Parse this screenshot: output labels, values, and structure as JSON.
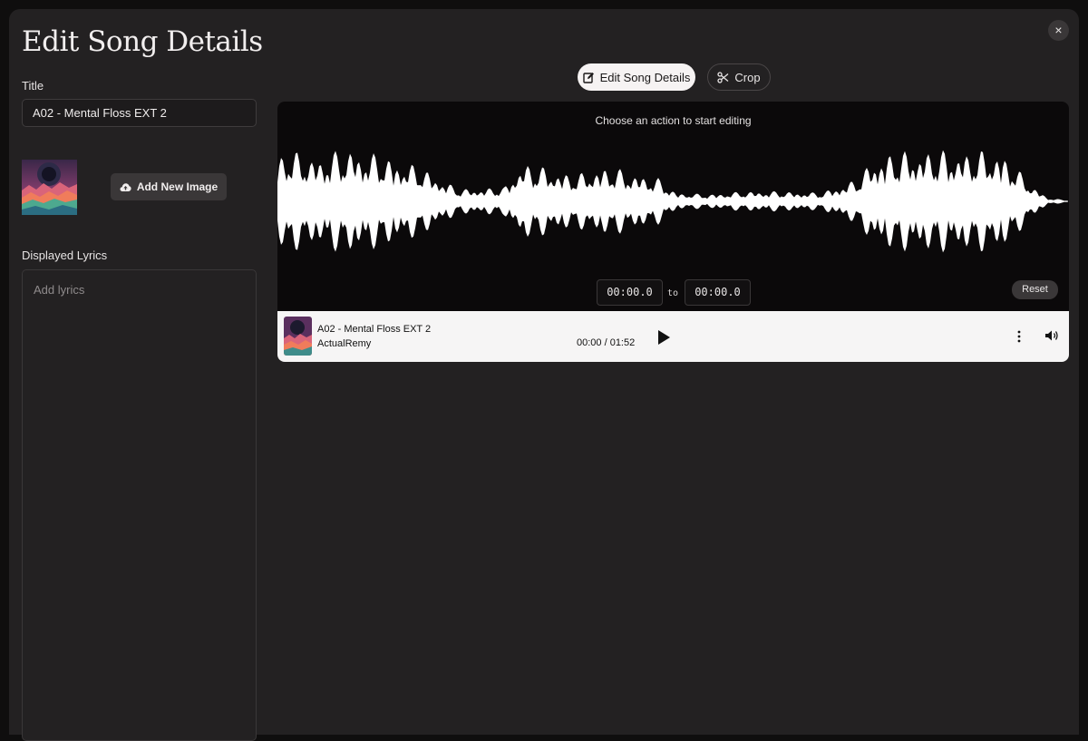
{
  "modal": {
    "title": "Edit Song Details",
    "close_icon": "×"
  },
  "form": {
    "title_label": "Title",
    "title_value": "A02 - Mental Floss EXT 2",
    "add_image_label": "Add New Image",
    "lyrics_label": "Displayed Lyrics",
    "lyrics_placeholder": "Add lyrics"
  },
  "tabs": [
    {
      "label": "Edit Song Details",
      "icon": "edit-icon",
      "active": true
    },
    {
      "label": "Crop",
      "icon": "scissors-icon",
      "active": false
    }
  ],
  "editor": {
    "hint": "Choose an action to start editing",
    "start_time": "00:00.0",
    "to_label": "to",
    "end_time": "00:00.0",
    "reset_label": "Reset"
  },
  "player": {
    "track_title": "A02 - Mental Floss EXT 2",
    "artist": "ActualRemy",
    "time": "00:00 / 01:52"
  },
  "colors": {
    "background": "#232122",
    "editor_background": "#0b090a",
    "waveform": "#ffffff",
    "player_background": "#f6f5f5"
  }
}
